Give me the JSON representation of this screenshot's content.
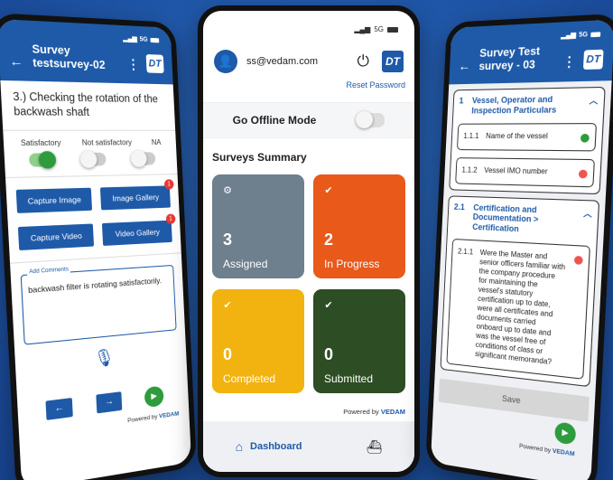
{
  "left": {
    "status": "5G",
    "title": "Survey testsurvey-02",
    "logo": "DT",
    "question": "3.) Checking the rotation of the backwash shaft",
    "options": [
      "Satisfactory",
      "Not satisfactory",
      "NA"
    ],
    "buttons": {
      "capture_image": "Capture Image",
      "image_gallery": "Image Gallery",
      "capture_video": "Capture Video",
      "video_gallery": "Video Gallery",
      "image_badge": "1",
      "video_badge": "1"
    },
    "comments_label": "Add Comments",
    "comments_value": "backwash filter is rotating satisfactorily.",
    "prev": "←",
    "next": "→",
    "powered_by": "Powered by",
    "brand": "VEDAM"
  },
  "center": {
    "status": "5G",
    "email": "ss@vedam.com",
    "logo": "DT",
    "reset_password": "Reset Password",
    "offline_mode": "Go Offline Mode",
    "summary_title": "Surveys Summary",
    "cards": [
      {
        "count": "3",
        "label": "Assigned",
        "color": "#6e7f8d"
      },
      {
        "count": "2",
        "label": "In Progress",
        "color": "#e8591a"
      },
      {
        "count": "0",
        "label": "Completed",
        "color": "#f2b20f"
      },
      {
        "count": "0",
        "label": "Submitted",
        "color": "#2d4d24"
      }
    ],
    "powered_by": "Powered by",
    "brand": "VEDAM",
    "nav_dashboard": "Dashboard"
  },
  "right": {
    "status": "5G",
    "title": "Survey Test survey - 03",
    "logo": "DT",
    "sections": [
      {
        "num": "1",
        "title": "Vessel, Operator and Inspection Particulars"
      },
      {
        "num": "2.1",
        "title": "Certification and Documentation > Certification"
      }
    ],
    "items": [
      {
        "num": "1.1.1",
        "text": "Name of the vessel",
        "color": "#2e9b3c"
      },
      {
        "num": "1.1.2",
        "text": "Vessel IMO number",
        "color": "#ef5350"
      },
      {
        "num": "2.1.1",
        "text": "Were the Master and senior officers familiar with the company procedure for maintaining the vessel's statutory certification up to date, were all certificates and documents carried onboard up to date and was the vessel free of conditions of class or significant memoranda?",
        "color": "#ef5350"
      }
    ],
    "save": "Save",
    "powered_by": "Powered by",
    "brand": "VEDAM"
  }
}
